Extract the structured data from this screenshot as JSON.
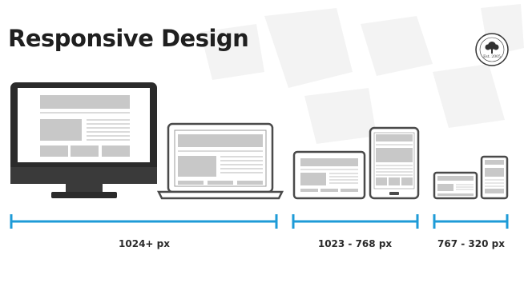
{
  "title": "Responsive Design",
  "logo": {
    "label": "Est. 2005"
  },
  "ranges": [
    {
      "label": "1024+ px"
    },
    {
      "label": "1023 - 768 px"
    },
    {
      "label": "767 - 320 px"
    }
  ],
  "colors": {
    "device_dark": "#2b2b2b",
    "device_grey": "#5a5a5a",
    "screen_bg": "#ffffff",
    "block": "#c8c8c8",
    "line": "#cfcfcf",
    "accent": "#1e9bd7",
    "watermark": "#f2f2f2"
  }
}
